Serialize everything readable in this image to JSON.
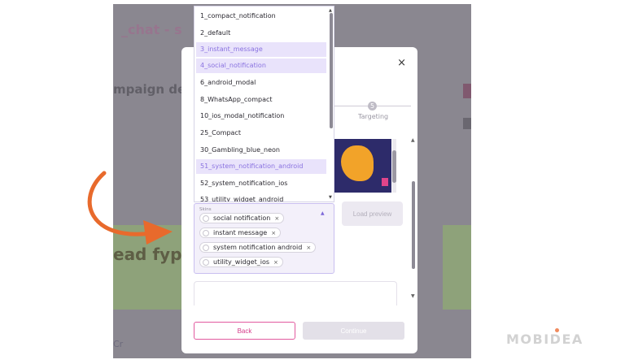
{
  "dropdown": {
    "items": [
      {
        "label": "1_compact_notification",
        "selected": false
      },
      {
        "label": "2_default",
        "selected": false
      },
      {
        "label": "3_instant_message",
        "selected": true
      },
      {
        "label": "4_social_notification",
        "selected": true
      },
      {
        "label": "6_android_modal",
        "selected": false
      },
      {
        "label": "8_WhatsApp_compact",
        "selected": false
      },
      {
        "label": "10_ios_modal_notification",
        "selected": false
      },
      {
        "label": "25_Compact",
        "selected": false
      },
      {
        "label": "30_Gambling_blue_neon",
        "selected": false
      },
      {
        "label": "51_system_notification_android",
        "selected": true
      },
      {
        "label": "52_system_notification_ios",
        "selected": false
      },
      {
        "label": "53_utility_widget_android",
        "selected": false
      }
    ]
  },
  "skins": {
    "label": "Skins",
    "chips": [
      {
        "label": "social notification",
        "remove": "×"
      },
      {
        "label": "instant message",
        "remove": "×"
      },
      {
        "label": "system notification android",
        "remove": "×"
      },
      {
        "label": "utility_widget_ios",
        "remove": "×"
      }
    ]
  },
  "modal": {
    "close": "×",
    "step_number": "5",
    "step_label": "Targeting",
    "load_preview": "Load preview",
    "back": "Back",
    "continue": "Continue"
  },
  "backdrop": {
    "text_pink": "_chat - s",
    "text_dark": "mpaign deal",
    "text_green": "ead fyp",
    "link_text": "Cr"
  },
  "logo": {
    "text": "MOBIDEA"
  },
  "colors": {
    "accent_purple": "#8a73e0",
    "accent_pink": "#d63b8a",
    "arrow_orange": "#e86a2c"
  }
}
